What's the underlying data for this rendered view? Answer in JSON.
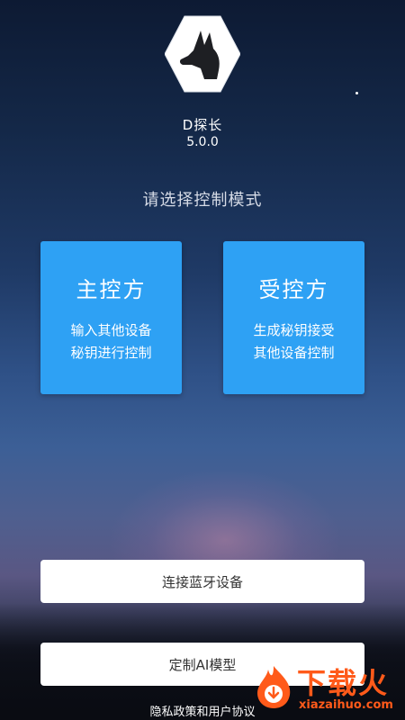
{
  "app": {
    "name": "D探长",
    "version": "5.0.0",
    "logo_icon": "dog-head-icon"
  },
  "prompt": "请选择控制模式",
  "modes": [
    {
      "title": "主控方",
      "desc_line1": "输入其他设备",
      "desc_line2": "秘钥进行控制"
    },
    {
      "title": "受控方",
      "desc_line1": "生成秘钥接受",
      "desc_line2": "其他设备控制"
    }
  ],
  "actions": {
    "bluetooth_label": "连接蓝牙设备",
    "ai_model_label": "定制AI模型"
  },
  "footer": {
    "privacy_label": "隐私政策和用户协议"
  },
  "watermark": {
    "text": "下载火",
    "url": "xiazaihuo.com"
  },
  "colors": {
    "mode_card": "#2ea1f4",
    "watermark": "#ff5a1a"
  }
}
